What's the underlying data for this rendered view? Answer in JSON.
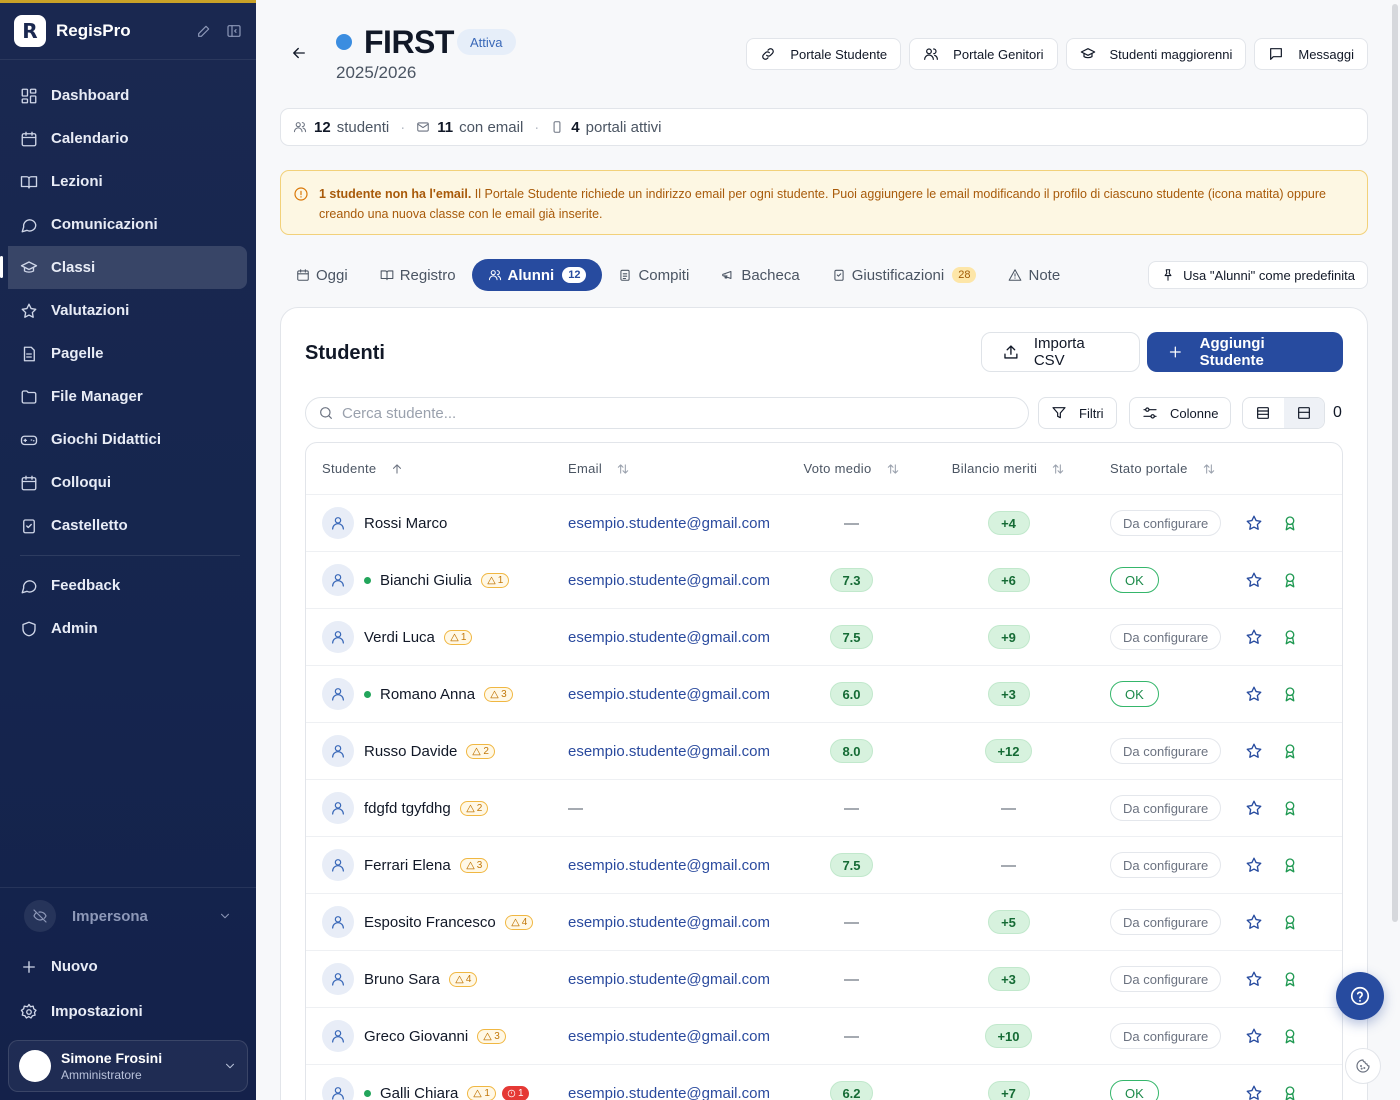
{
  "sidebar": {
    "brand": "RegisPro",
    "items": [
      {
        "label": "Dashboard",
        "icon": "dashboard-icon"
      },
      {
        "label": "Calendario",
        "icon": "calendar-icon"
      },
      {
        "label": "Lezioni",
        "icon": "book-icon"
      },
      {
        "label": "Comunicazioni",
        "icon": "chat-icon"
      },
      {
        "label": "Classi",
        "icon": "graduation-cap-icon",
        "active": true
      },
      {
        "label": "Valutazioni",
        "icon": "star-icon"
      },
      {
        "label": "Pagelle",
        "icon": "document-icon"
      },
      {
        "label": "File Manager",
        "icon": "folder-icon"
      },
      {
        "label": "Giochi Didattici",
        "icon": "gamepad-icon"
      },
      {
        "label": "Colloqui",
        "icon": "calendar-icon"
      },
      {
        "label": "Castelletto",
        "icon": "clipboard-icon"
      }
    ],
    "items2": [
      {
        "label": "Feedback",
        "icon": "chat-icon"
      },
      {
        "label": "Admin",
        "icon": "shield-icon"
      }
    ],
    "impersona": "Impersona",
    "nuovo": "Nuovo",
    "impostazioni": "Impostazioni",
    "user": {
      "name": "Simone Frosini",
      "role": "Amministratore"
    }
  },
  "header": {
    "title": "FIRST",
    "status": "Attiva",
    "year": "2025/2026",
    "buttons": [
      "Portale Studente",
      "Portale Genitori",
      "Studenti maggiorenni",
      "Messaggi"
    ]
  },
  "stats": {
    "students_count": "12",
    "students_label": "studenti",
    "email_count": "11",
    "email_label": "con email",
    "portals_count": "4",
    "portals_label": "portali attivi"
  },
  "alert": {
    "bold": "1 studente non ha l'email.",
    "text": " Il Portale Studente richiede un indirizzo email per ogni studente. Puoi aggiungere le email modificando il profilo di ciascuno studente (icona matita) oppure creando una nuova classe con le email già inserite."
  },
  "tabs": [
    {
      "label": "Oggi"
    },
    {
      "label": "Registro"
    },
    {
      "label": "Alunni",
      "count": "12",
      "active": true
    },
    {
      "label": "Compiti"
    },
    {
      "label": "Bacheca"
    },
    {
      "label": "Giustificazioni",
      "count": "28"
    },
    {
      "label": "Note"
    }
  ],
  "tab_pref": "Usa \"Alunni\" come predefinita",
  "students": {
    "title": "Studenti",
    "import": "Importa CSV",
    "add": "Aggiungi Studente",
    "search_placeholder": "Cerca studente...",
    "filters": "Filtri",
    "columns": "Colonne",
    "selected": "0",
    "headers": [
      "Studente",
      "Email",
      "Voto medio",
      "Bilancio meriti",
      "Stato portale"
    ],
    "rows": [
      {
        "name": "Rossi Marco",
        "online": false,
        "warn": "",
        "red": "",
        "email": "esempio.studente@gmail.com",
        "grade": "",
        "merit": "+4",
        "portal": "Da configurare"
      },
      {
        "name": "Bianchi Giulia",
        "online": true,
        "warn": "1",
        "red": "",
        "email": "esempio.studente@gmail.com",
        "grade": "7.3",
        "merit": "+6",
        "portal": "OK"
      },
      {
        "name": "Verdi Luca",
        "online": false,
        "warn": "1",
        "red": "",
        "email": "esempio.studente@gmail.com",
        "grade": "7.5",
        "merit": "+9",
        "portal": "Da configurare"
      },
      {
        "name": "Romano Anna",
        "online": true,
        "warn": "3",
        "red": "",
        "email": "esempio.studente@gmail.com",
        "grade": "6.0",
        "merit": "+3",
        "portal": "OK"
      },
      {
        "name": "Russo Davide",
        "online": false,
        "warn": "2",
        "red": "",
        "email": "esempio.studente@gmail.com",
        "grade": "8.0",
        "merit": "+12",
        "portal": "Da configurare"
      },
      {
        "name": "fdgfd tgyfdhg",
        "online": false,
        "warn": "2",
        "red": "",
        "email": "",
        "grade": "",
        "merit": "",
        "portal": "Da configurare"
      },
      {
        "name": "Ferrari Elena",
        "online": false,
        "warn": "3",
        "red": "",
        "email": "esempio.studente@gmail.com",
        "grade": "7.5",
        "merit": "",
        "portal": "Da configurare"
      },
      {
        "name": "Esposito Francesco",
        "online": false,
        "warn": "4",
        "red": "",
        "email": "esempio.studente@gmail.com",
        "grade": "",
        "merit": "+5",
        "portal": "Da configurare"
      },
      {
        "name": "Bruno Sara",
        "online": false,
        "warn": "4",
        "red": "",
        "email": "esempio.studente@gmail.com",
        "grade": "",
        "merit": "+3",
        "portal": "Da configurare"
      },
      {
        "name": "Greco Giovanni",
        "online": false,
        "warn": "3",
        "red": "",
        "email": "esempio.studente@gmail.com",
        "grade": "",
        "merit": "+10",
        "portal": "Da configurare"
      },
      {
        "name": "Galli Chiara",
        "online": true,
        "warn": "1",
        "red": "1",
        "email": "esempio.studente@gmail.com",
        "grade": "6.2",
        "merit": "+7",
        "portal": "OK"
      }
    ]
  },
  "colors": {
    "primary": "#274b9f",
    "sidebar": "#1a2850",
    "accent_gold": "#c9a227",
    "success": "#22a55b",
    "warning": "#f0b742"
  }
}
